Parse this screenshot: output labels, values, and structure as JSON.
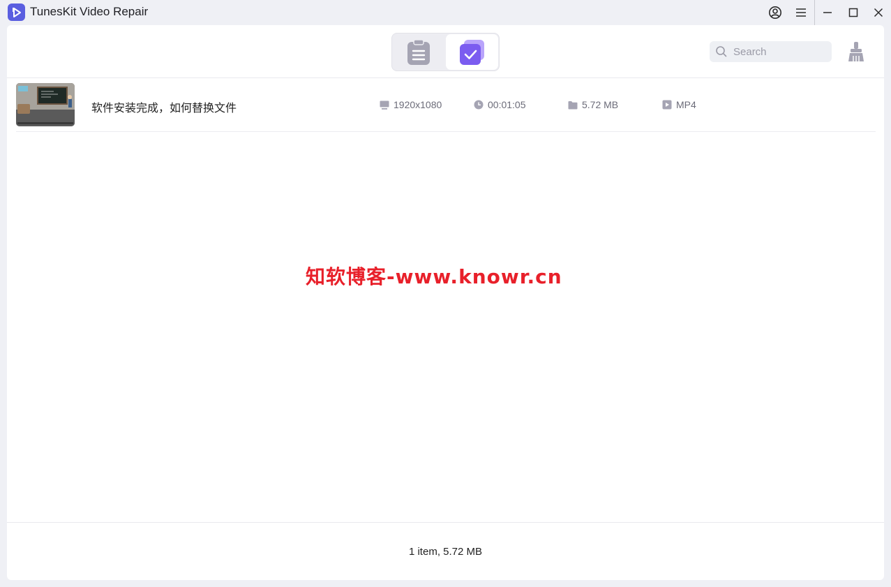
{
  "window": {
    "title": "TunesKit Video Repair",
    "controls": [
      "account-icon",
      "menu-icon",
      "minimize-icon",
      "maximize-icon",
      "close-icon"
    ]
  },
  "toolbar": {
    "tabs": [
      {
        "icon": "file-list-icon",
        "active": false
      },
      {
        "icon": "repaired-check-icon",
        "active": true
      }
    ],
    "search": {
      "placeholder": "Search",
      "value": ""
    },
    "clean_icon": "broom-icon"
  },
  "files": [
    {
      "name": "软件安装完成，如何替换文件",
      "resolution": "1920x1080",
      "duration": "00:01:05",
      "size": "5.72 MB",
      "format": "MP4"
    }
  ],
  "watermark": "知软博客-www.knowr.cn",
  "footer": {
    "status": "1 item, 5.72 MB"
  },
  "colors": {
    "accent": "#7b5cf0",
    "background": "#eff0f5",
    "watermark": "#e8202a"
  }
}
